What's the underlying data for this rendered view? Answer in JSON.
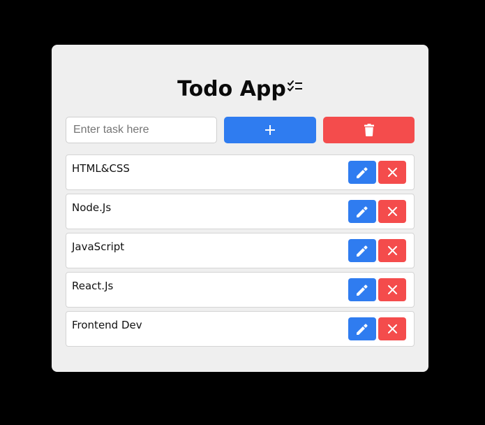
{
  "app": {
    "title": "Todo App",
    "title_icon": "checklist-icon"
  },
  "input": {
    "placeholder": "Enter task here",
    "value": ""
  },
  "buttons": {
    "add_icon": "plus-icon",
    "clear_icon": "trash-icon",
    "edit_icon": "pencil-icon",
    "delete_icon": "close-icon"
  },
  "tasks": [
    {
      "label": "HTML&CSS"
    },
    {
      "label": "Node.Js"
    },
    {
      "label": "JavaScript"
    },
    {
      "label": "React.Js"
    },
    {
      "label": "Frontend Dev"
    }
  ],
  "colors": {
    "background": "#000000",
    "card": "#efefef",
    "primary": "#2f7cf0",
    "danger": "#f44c4c"
  }
}
